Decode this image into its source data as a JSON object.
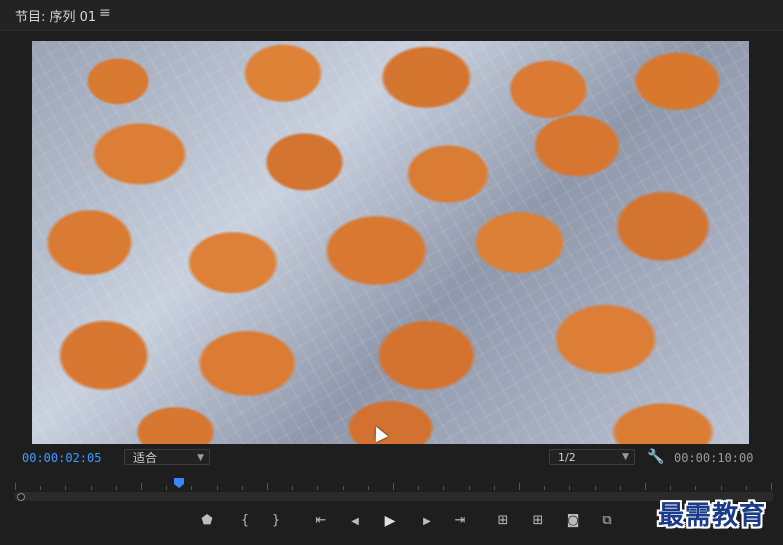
{
  "panel": {
    "title": "节目: 序列 01",
    "menu_icon": "hamburger-menu-icon"
  },
  "viewer": {
    "current_timecode": "00:00:02:05",
    "fit_label": "适合",
    "resolution_label": "1/2",
    "duration_timecode": "00:00:10:00",
    "settings_icon": "wrench-icon"
  },
  "timeline": {
    "playhead_icon": "playhead-marker-icon",
    "zoom_handle_icon": "zoom-handle-icon"
  },
  "controls": [
    {
      "name": "add-marker-button",
      "glyph": "⬟",
      "icon": "marker-icon"
    },
    {
      "name": "mark-in-button",
      "glyph": "{",
      "icon": "mark-in-icon"
    },
    {
      "name": "mark-out-button",
      "glyph": "}",
      "icon": "mark-out-icon"
    },
    {
      "name": "go-to-in-button",
      "glyph": "⇤",
      "icon": "go-to-in-icon"
    },
    {
      "name": "step-back-button",
      "glyph": "◀",
      "icon": "step-back-icon"
    },
    {
      "name": "play-button",
      "glyph": "▶",
      "icon": "play-icon"
    },
    {
      "name": "step-forward-button",
      "glyph": "▶",
      "icon": "step-forward-icon"
    },
    {
      "name": "go-to-out-button",
      "glyph": "⇥",
      "icon": "go-to-out-icon"
    },
    {
      "name": "lift-button",
      "glyph": "⊞",
      "icon": "lift-icon"
    },
    {
      "name": "extract-button",
      "glyph": "⊞",
      "icon": "extract-icon"
    },
    {
      "name": "export-frame-button",
      "glyph": "◙",
      "icon": "camera-icon"
    },
    {
      "name": "comparison-view-button",
      "glyph": "⧉",
      "icon": "comparison-view-icon"
    }
  ],
  "watermark": {
    "text": "最需教育"
  }
}
